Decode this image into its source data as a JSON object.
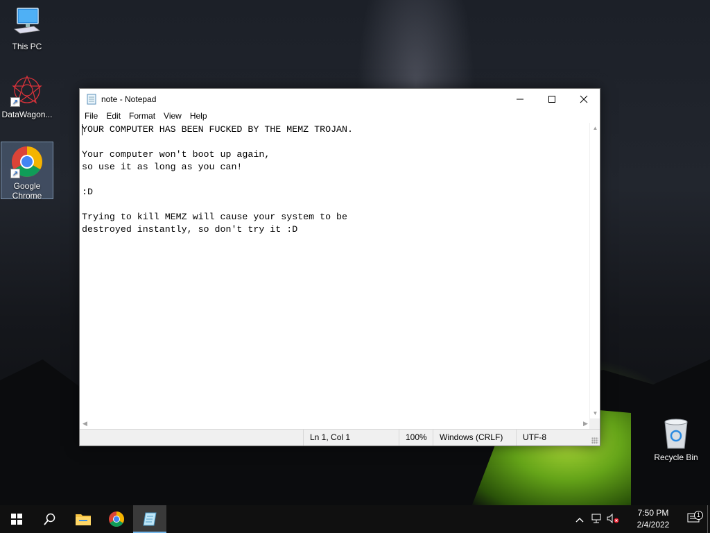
{
  "desktop": {
    "icons": [
      {
        "label": "This PC",
        "icon": "computer-icon"
      },
      {
        "label": "DataWagon...",
        "icon": "datawagon-icon"
      },
      {
        "label": "Google Chrome",
        "icon": "chrome-icon"
      },
      {
        "label": "Recycle Bin",
        "icon": "recycle-bin-icon"
      }
    ]
  },
  "window": {
    "title": "note - Notepad",
    "menu": [
      "File",
      "Edit",
      "Format",
      "View",
      "Help"
    ],
    "content": "YOUR COMPUTER HAS BEEN FUCKED BY THE MEMZ TROJAN.\n\nYour computer won't boot up again,\nso use it as long as you can!\n\n:D\n\nTrying to kill MEMZ will cause your system to be\ndestroyed instantly, so don't try it :D",
    "status": {
      "position": "Ln 1, Col 1",
      "zoom": "100%",
      "line_ending": "Windows (CRLF)",
      "encoding": "UTF-8"
    }
  },
  "taskbar": {
    "clock_time": "7:50 PM",
    "clock_date": "2/4/2022",
    "notification_count": "1"
  }
}
